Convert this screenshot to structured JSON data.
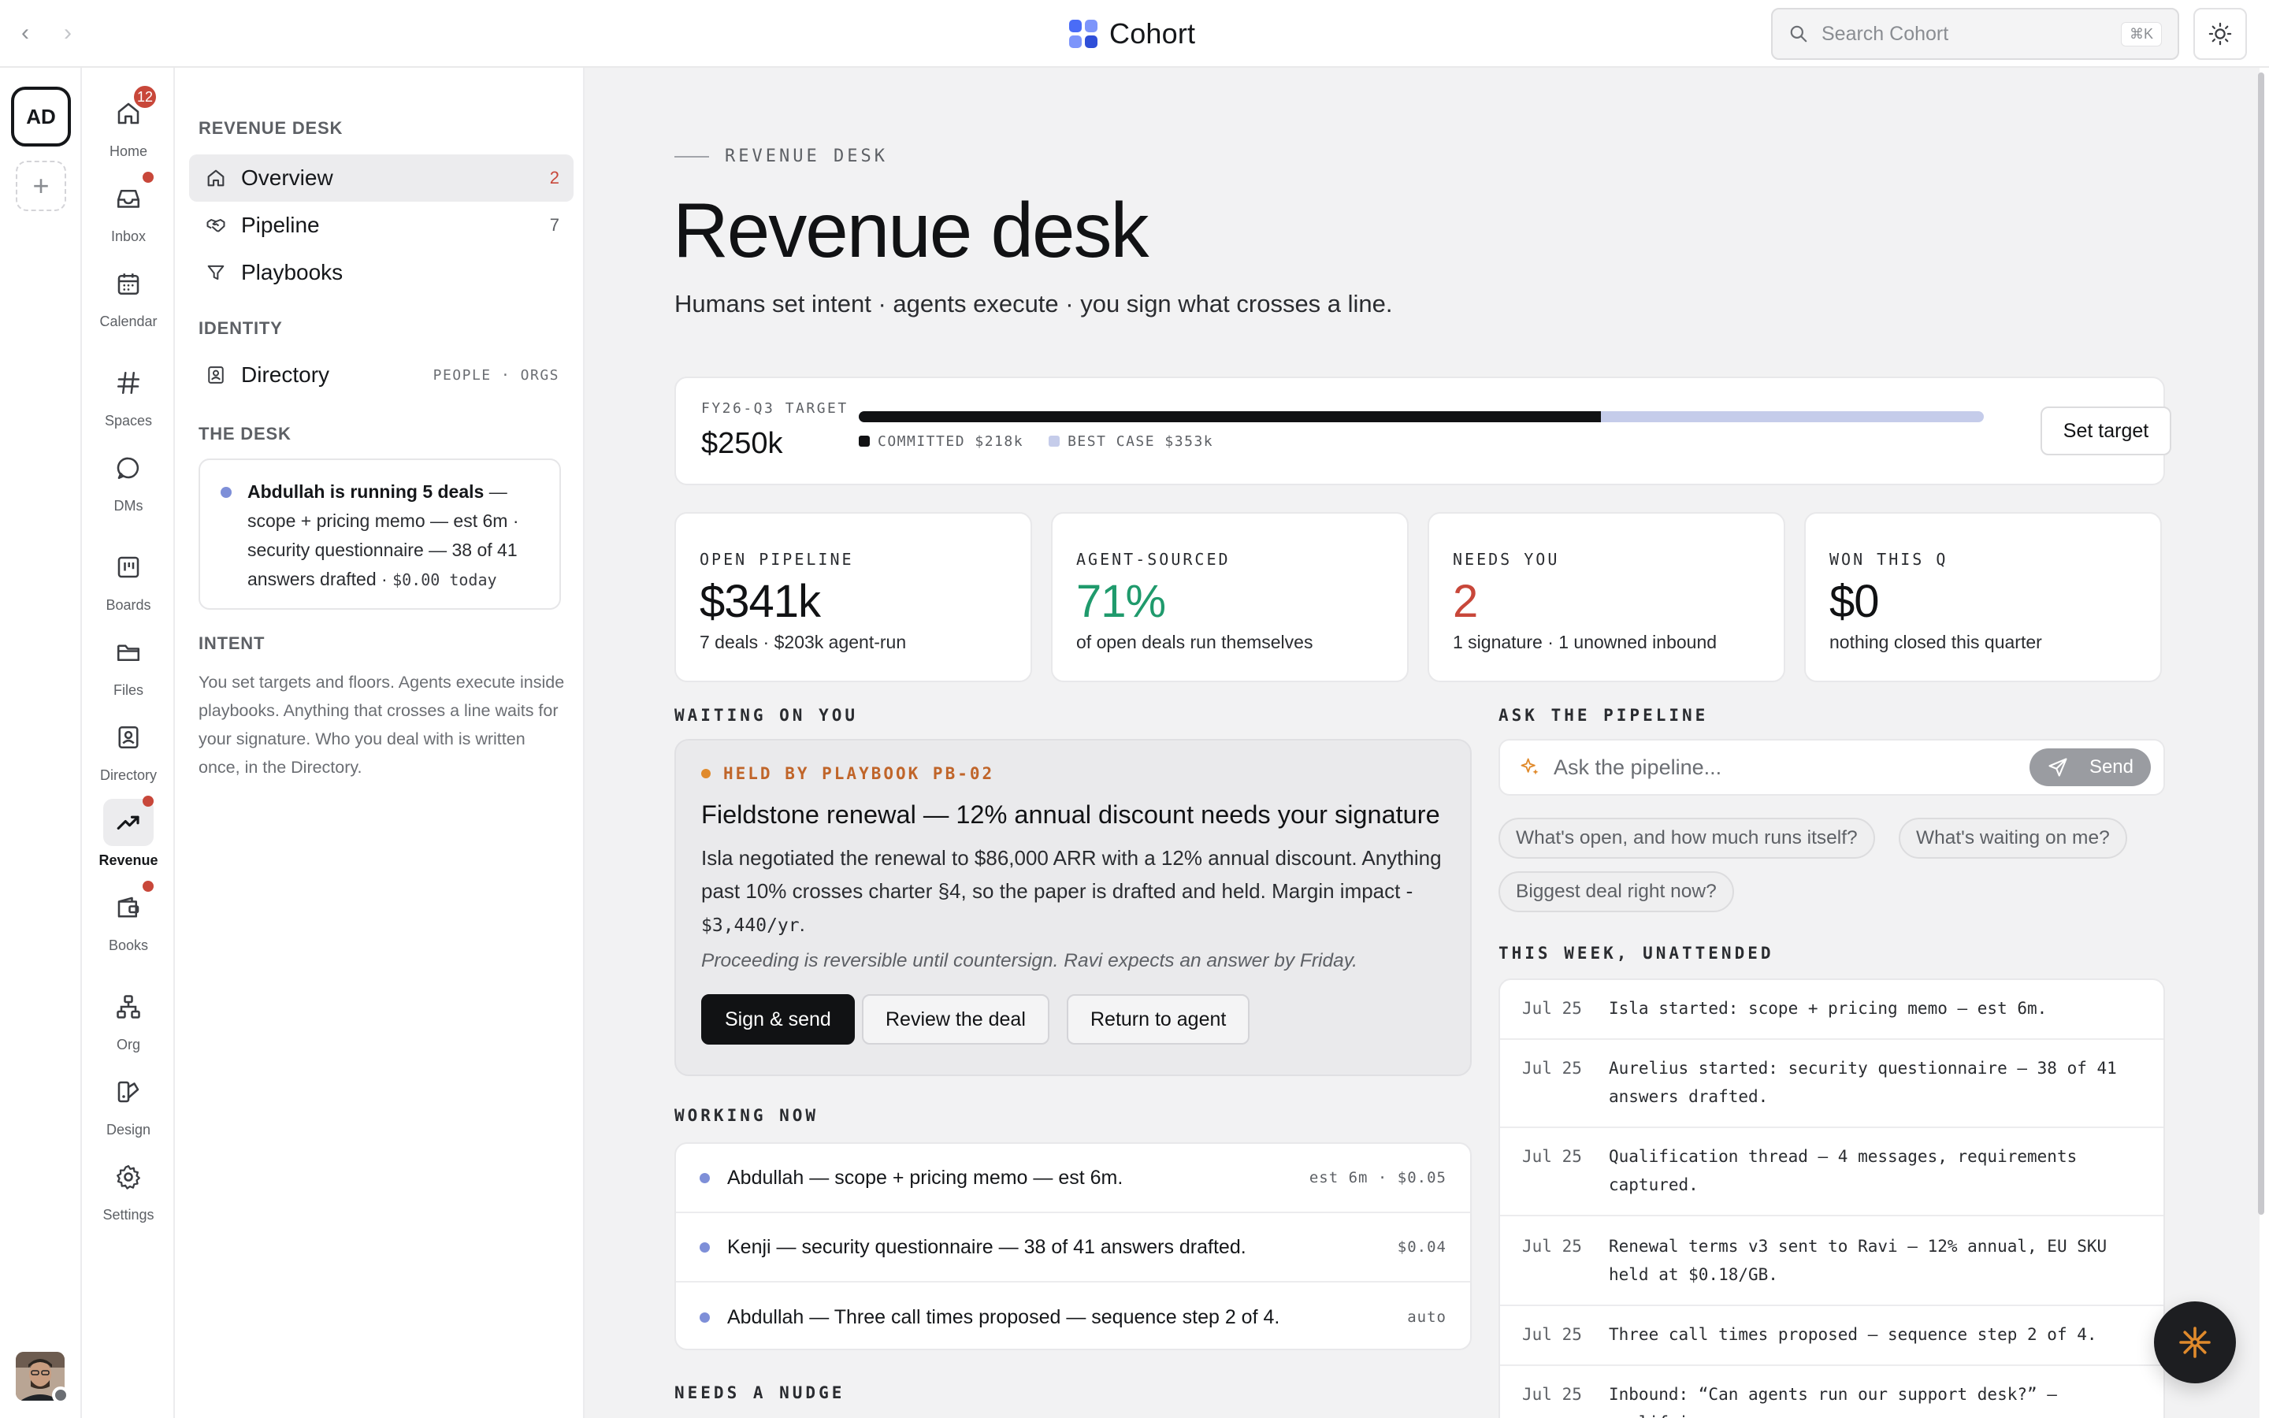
{
  "app": {
    "name": "Cohort"
  },
  "search": {
    "placeholder": "Search Cohort",
    "shortcut": "⌘K"
  },
  "workspace": {
    "initials": "AD"
  },
  "apps": [
    {
      "label": "Home",
      "icon": "home-icon",
      "badge": "12"
    },
    {
      "label": "Inbox",
      "icon": "inbox-icon",
      "dot": true
    },
    {
      "label": "Calendar",
      "icon": "calendar-icon"
    },
    {
      "label": "Spaces",
      "icon": "hash-icon"
    },
    {
      "label": "DMs",
      "icon": "chat-icon"
    },
    {
      "label": "Boards",
      "icon": "board-icon"
    },
    {
      "label": "Files",
      "icon": "folder-icon"
    },
    {
      "label": "Directory",
      "icon": "contact-icon"
    },
    {
      "label": "Revenue",
      "icon": "trend-up-icon",
      "dot": true,
      "active": true
    },
    {
      "label": "Books",
      "icon": "wallet-icon",
      "dot": true
    },
    {
      "label": "Org",
      "icon": "org-chart-icon"
    },
    {
      "label": "Design",
      "icon": "design-icon"
    },
    {
      "label": "Settings",
      "icon": "gear-icon"
    }
  ],
  "sidebar": {
    "revenue_section": "REVENUE DESK",
    "items": [
      {
        "label": "Overview",
        "count": "2"
      },
      {
        "label": "Pipeline",
        "count": "7"
      },
      {
        "label": "Playbooks"
      }
    ],
    "identity_section": "IDENTITY",
    "directory": {
      "label": "Directory",
      "tags": "PEOPLE · ORGS"
    },
    "desk_section": "THE DESK",
    "desk_card": {
      "bold": "Abdullah is running 5 deals",
      "text": " — scope + pricing memo — est 6m · security questionnaire — 38 of 41 answers drafted · ",
      "cost": "$0.00 today"
    },
    "intent_section": "INTENT",
    "intent_text": "You set targets and floors. Agents execute inside playbooks. Anything that crosses a line waits for your signature. Who you deal with is written once, in the Directory."
  },
  "main": {
    "eyebrow": "REVENUE DESK",
    "title": "Revenue desk",
    "subtitle": "Humans set intent · agents execute · you sign what crosses a line.",
    "target": {
      "label": "FY26-Q3 TARGET",
      "value": "$250k",
      "committed_label": "COMMITTED $218k",
      "best_case_label": "BEST CASE $353k",
      "committed_fraction": 0.66,
      "committed_color": "#111214",
      "best_case_color": "#c5ccea",
      "button": "Set target"
    },
    "stats": [
      {
        "label": "OPEN PIPELINE",
        "value": "$341k",
        "desc": "7 deals · $203k agent-run",
        "color": "#111214"
      },
      {
        "label": "AGENT-SOURCED",
        "value": "71%",
        "desc": "of open deals run themselves",
        "color": "#1f9a6c"
      },
      {
        "label": "NEEDS YOU",
        "value": "2",
        "desc": "1 signature · 1 unowned inbound",
        "color": "#c8473a"
      },
      {
        "label": "WON THIS Q",
        "value": "$0",
        "desc": "nothing closed this quarter",
        "color": "#111214"
      }
    ],
    "waiting": {
      "heading": "WAITING ON YOU",
      "tag": "HELD BY PLAYBOOK PB-02",
      "title": "Fieldstone renewal — 12% annual discount needs your signature",
      "body": "Isla negotiated the renewal to $86,000 ARR with a 12% annual discount. Anything past 10% crosses charter §4, so the paper is drafted and held. Margin impact -",
      "impact": "$3,440/yr",
      "note": "Proceeding is reversible until countersign. Ravi expects an answer by Friday.",
      "buttons": {
        "sign": "Sign & send",
        "review": "Review the deal",
        "return": "Return to agent"
      }
    },
    "working": {
      "heading": "WORKING NOW",
      "rows": [
        {
          "text": "Abdullah — scope + pricing memo — est 6m.",
          "meta": "est 6m · $0.05"
        },
        {
          "text": "Kenji — security questionnaire — 38 of 41 answers drafted.",
          "meta": "$0.04"
        },
        {
          "text": "Abdullah — Three call times proposed — sequence step 2 of 4.",
          "meta": "auto"
        }
      ]
    },
    "nudge_heading": "NEEDS A NUDGE",
    "ask": {
      "heading": "ASK THE PIPELINE",
      "placeholder": "Ask the pipeline...",
      "send": "Send",
      "chips": [
        "What's open, and how much runs itself?",
        "What's waiting on me?",
        "Biggest deal right now?"
      ]
    },
    "week": {
      "heading": "THIS WEEK, UNATTENDED",
      "rows": [
        {
          "date": "Jul 25",
          "text": "Isla started: scope + pricing memo — est 6m."
        },
        {
          "date": "Jul 25",
          "text": "Aurelius started: security questionnaire — 38 of 41 answers drafted."
        },
        {
          "date": "Jul 25",
          "text": "Qualification thread — 4 messages, requirements captured."
        },
        {
          "date": "Jul 25",
          "text": "Renewal terms v3 sent to Ravi — 12% annual, EU SKU held at $0.18/GB."
        },
        {
          "date": "Jul 25",
          "text": "Three call times proposed — sequence step 2 of 4."
        },
        {
          "date": "Jul 25",
          "text": "Inbound: “Can agents run our support desk?” — qualifying"
        }
      ]
    }
  }
}
